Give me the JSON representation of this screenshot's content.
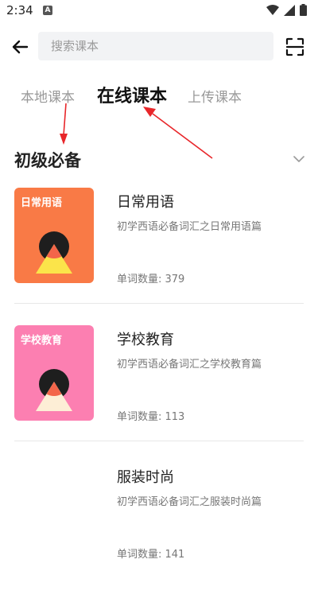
{
  "status_bar": {
    "time": "2:34",
    "badge": "A",
    "icons": [
      "wifi-icon",
      "cell-signal-icon",
      "battery-icon"
    ]
  },
  "search": {
    "placeholder": "搜索课本",
    "value": ""
  },
  "icons": {
    "back": "back-arrow-icon",
    "scan": "scan-icon",
    "toggle": "chevron-down-icon"
  },
  "tabs": [
    {
      "label": "本地课本",
      "active": false
    },
    {
      "label": "在线课本",
      "active": true
    },
    {
      "label": "上传课本",
      "active": false
    }
  ],
  "section": {
    "title": "初级必备"
  },
  "books": [
    {
      "cover_label": "日常用语",
      "cover_color": "#f97a46",
      "title": "日常用语",
      "description": "初学西语必备词汇之日常用语篇",
      "count": "单词数量: 379"
    },
    {
      "cover_label": "学校教育",
      "cover_color": "#fc7fb1",
      "title": "学校教育",
      "description": "初学西语必备词汇之学校教育篇",
      "count": "单词数量: 113"
    },
    {
      "cover_label": "",
      "cover_color": "#ffffff",
      "title": "服装时尚",
      "description": "初学西语必备词汇之服装时尚篇",
      "count": "单词数量: 141"
    }
  ],
  "colors": {
    "annotation_arrow": "#e8262a",
    "inactive_tab": "#999999",
    "active_tab": "#111111"
  }
}
